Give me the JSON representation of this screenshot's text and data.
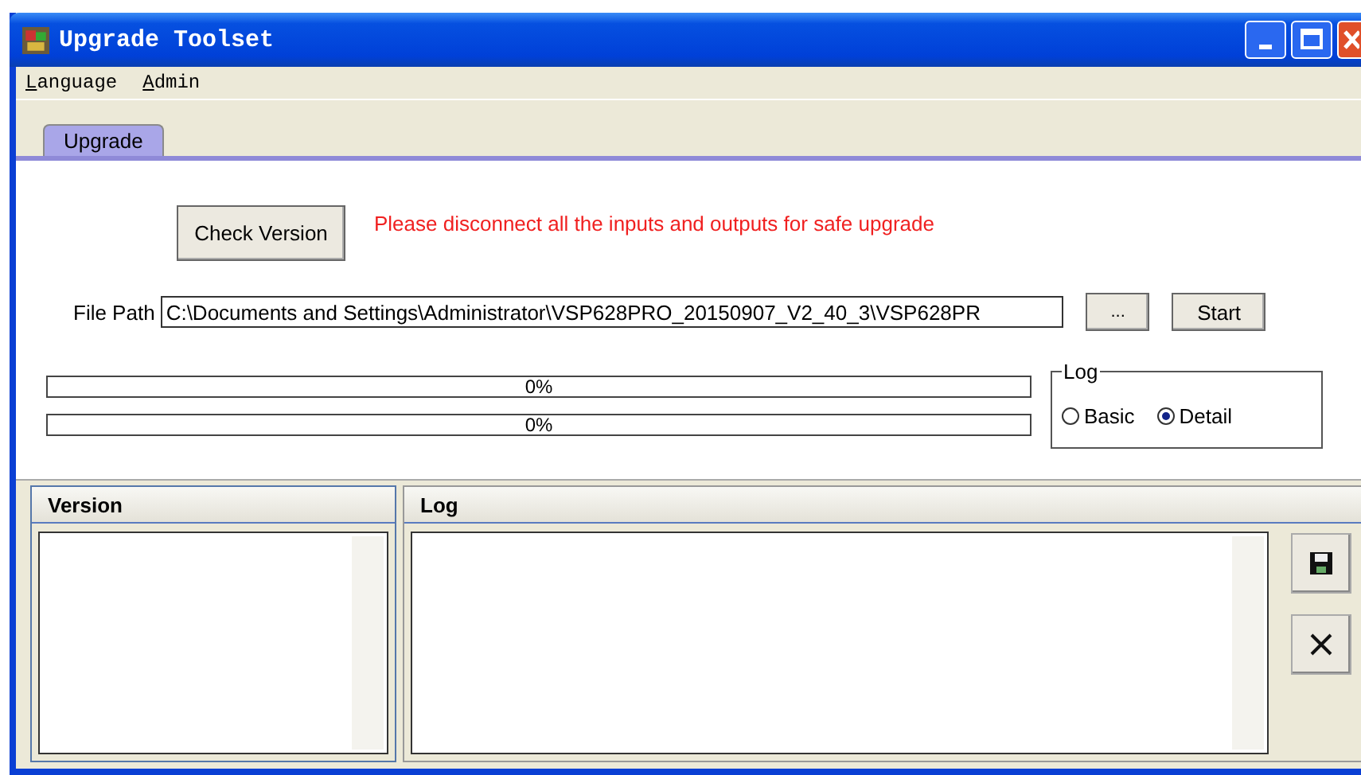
{
  "window": {
    "title": "Upgrade Toolset"
  },
  "menu": [
    {
      "label": "Language"
    },
    {
      "label": "Admin"
    }
  ],
  "tabs": [
    {
      "label": "Upgrade",
      "selected": true
    }
  ],
  "check_button": "Check Version",
  "warning": "Please disconnect all the inputs and outputs for safe upgrade",
  "file_path": {
    "label": "File Path",
    "value": "C:\\Documents and Settings\\Administrator\\VSP628PRO_20150907_V2_40_3\\VSP628PR"
  },
  "browse_button": "...",
  "start_button": "Start",
  "progress": [
    {
      "level": 0,
      "reading": "0%"
    },
    {
      "level": 0,
      "reading": "0%"
    }
  ],
  "log_group": {
    "title": "Log",
    "options": [
      {
        "label": "Basic",
        "selected": false
      },
      {
        "label": "Detail",
        "selected": true
      }
    ]
  },
  "version_panel": {
    "header": "Version"
  },
  "log_panel": {
    "header": "Log"
  }
}
